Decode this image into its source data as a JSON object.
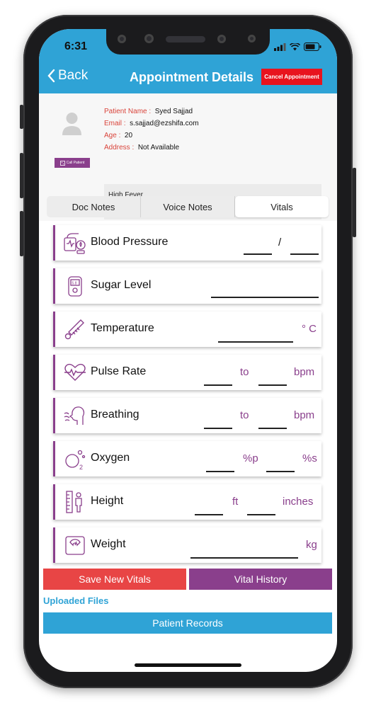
{
  "status": {
    "time": "6:31"
  },
  "header": {
    "back_label": "Back",
    "title": "Appointment Details",
    "cancel_label": "Cancel Appointment"
  },
  "patient": {
    "name_label": "Patient Name :",
    "name": "Syed Sajjad",
    "email_label": "Email :",
    "email": "s.sajjad@ezshifa.com",
    "age_label": "Age :",
    "age": "20",
    "address_label": "Address :",
    "address": "Not Available",
    "call_label": "Call Patient",
    "note": "High Fever"
  },
  "tabs": [
    {
      "label": "Doc Notes"
    },
    {
      "label": "Voice Notes"
    },
    {
      "label": "Vitals",
      "active": true
    }
  ],
  "vitals": {
    "blood_pressure": {
      "label": "Blood Pressure",
      "separator": "/",
      "icon": "blood-pressure-icon"
    },
    "sugar": {
      "label": "Sugar Level",
      "icon": "glucometer-icon"
    },
    "temperature": {
      "label": "Temperature",
      "unit": "° C",
      "icon": "thermometer-icon"
    },
    "pulse": {
      "label": "Pulse Rate",
      "to": "to",
      "unit": "bpm",
      "icon": "heart-pulse-icon"
    },
    "breathing": {
      "label": "Breathing",
      "to": "to",
      "unit": "bpm",
      "icon": "breathing-icon"
    },
    "oxygen": {
      "label": "Oxygen",
      "unit_p": "%p",
      "unit_s": "%s",
      "icon": "oxygen-icon"
    },
    "height": {
      "label": "Height",
      "unit_ft": "ft",
      "unit_in": "inches",
      "icon": "height-icon"
    },
    "weight": {
      "label": "Weight",
      "unit": "kg",
      "icon": "weighing-scale-icon"
    }
  },
  "actions": {
    "save_label": "Save New Vitals",
    "history_label": "Vital History"
  },
  "files": {
    "uploaded_label": "Uploaded Files",
    "records_label": "Patient Records"
  },
  "colors": {
    "primary": "#2fa3d6",
    "accent": "#8a3f8c",
    "danger": "#e8141e",
    "save": "#e84545"
  }
}
